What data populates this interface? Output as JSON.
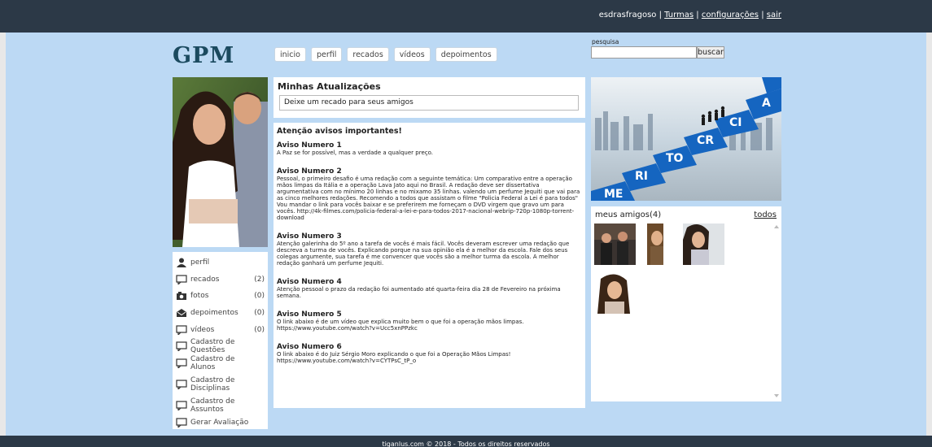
{
  "topbar": {
    "username": "esdrasfragoso",
    "links": [
      "Turmas",
      "configurações",
      "sair"
    ]
  },
  "logo": "GPM",
  "tabs": [
    "inicio",
    "perfil",
    "recados",
    "vídeos",
    "depoimentos"
  ],
  "search": {
    "label": "pesquisa",
    "button": "buscar",
    "value": ""
  },
  "menu": [
    {
      "label": "perfil",
      "count": "",
      "icon": "person-icon"
    },
    {
      "label": "recados",
      "count": "(2)",
      "icon": "speech-bubble-icon"
    },
    {
      "label": "fotos",
      "count": "(0)",
      "icon": "camera-icon"
    },
    {
      "label": "depoimentos",
      "count": "(0)",
      "icon": "envelope-icon"
    },
    {
      "label": "vídeos",
      "count": "(0)",
      "icon": "speech-bubble-icon"
    },
    {
      "label": "Cadastro de Questões",
      "count": "",
      "icon": "speech-bubble-icon"
    },
    {
      "label": "Cadastro de Alunos",
      "count": "",
      "icon": "speech-bubble-icon"
    },
    {
      "label": "Cadastro de Disciplinas",
      "count": "",
      "icon": "speech-bubble-icon"
    },
    {
      "label": "Cadastro de Assuntos",
      "count": "",
      "icon": "speech-bubble-icon"
    },
    {
      "label": "Gerar Avaliação",
      "count": "",
      "icon": "speech-bubble-icon"
    }
  ],
  "updates": {
    "title": "Minhas Atualizações",
    "input_value": "Deixe um recado para seus amigos"
  },
  "notices": {
    "heading": "Atenção avisos importantes!",
    "items": [
      {
        "title": "Aviso Numero 1",
        "body": "A Paz se for possível, mas a verdade a qualquer preço."
      },
      {
        "title": "Aviso Numero 2",
        "body": "Pessoal, o primeiro desafio é uma redação com a seguinte temática: Um comparativo entre a operação mãos limpas da Itália e a operação Lava Jato aqui no Brasil. A redação deve ser dissertativa argumentativa com no mínimo 20 linhas e no mixamo 35 linhas. valendo um perfume Jequiti que vai para as cinco melhores redações. Recomendo a todos que assistam o filme \"Policia Federal a Lei é para todos\" Vou mandar o link para vocês baixar e se preferirem me forneçam o DVD virgem que gravo um para vocês. http://4k-filmes.com/policia-federal-a-lei-e-para-todos-2017-nacional-webrip-720p-1080p-torrent-download"
      },
      {
        "title": "Aviso Numero 3",
        "body": "Atenção galerinha do 5º ano a tarefa de vocês é mais fácil. Vocês deveram escrever uma redação que descreva a turma de vocês. Explicando porque na sua opinião ela é a melhor da escola. Fale dos seus colegas argumente, sua tarefa é me convencer que vocês são a melhor turma da escola. A melhor redação ganhará um perfume Jequiti."
      },
      {
        "title": "Aviso Numero 4",
        "body": "Atenção pessoal o prazo da redação foi aumentado até quarta-feira dia 28 de Fevereiro na próxima semana."
      },
      {
        "title": "Aviso Numero 5",
        "body": "O link abaixo é de um vídeo que explica muito bem o que foi a operação mãos limpas. https://www.youtube.com/watch?v=Ucc5xnPPzkc"
      },
      {
        "title": "Aviso Numero 6",
        "body": "O link abaixo é do Juiz Sérgio Moro explicando o que foi a Operação Mãos Limpas! https://www.youtube.com/watch?v=CYTPsC_tP_o"
      }
    ]
  },
  "banner": {
    "word": "MERITOCRACIA",
    "steps": [
      "ME",
      "RI",
      "TO",
      "CR",
      "CI",
      "A"
    ]
  },
  "friends": {
    "title": "meus amigos(4)",
    "all_link": "todos"
  },
  "footer": "tiganlus.com © 2018 - Todos os direitos reservados",
  "colors": {
    "topbar": "#2c3947",
    "background": "#bcd9f4",
    "banner_steps": "#1565c0"
  }
}
